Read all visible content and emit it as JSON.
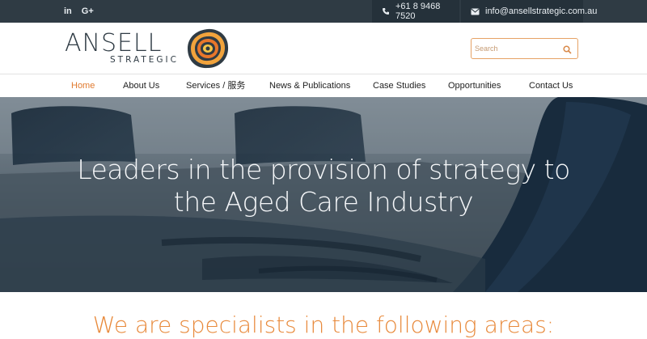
{
  "topbar": {
    "social": [
      {
        "name": "linkedin-icon",
        "glyph": "in"
      },
      {
        "name": "google-plus-icon",
        "glyph": "G+"
      }
    ],
    "phone": "+61 8 9468 7520",
    "email": "info@ansellstrategic.com.au"
  },
  "header": {
    "logo_word": "ANSELL",
    "logo_sub": "STRATEGIC",
    "search_placeholder": "Search"
  },
  "nav": {
    "items": [
      {
        "label": "Home",
        "active": true
      },
      {
        "label": "About Us"
      },
      {
        "label": "Services / 服务"
      },
      {
        "label": "News & Publications"
      },
      {
        "label": "Case Studies"
      },
      {
        "label": "Opportunities"
      },
      {
        "label": "Contact Us"
      }
    ]
  },
  "hero": {
    "title_line1": "Leaders in the provision of strategy to",
    "title_line2": "the Aged Care Industry"
  },
  "specialists": {
    "heading": "We are specialists in the following areas:"
  },
  "colors": {
    "accent": "#e07a2f",
    "topbar": "#2f3b44"
  }
}
